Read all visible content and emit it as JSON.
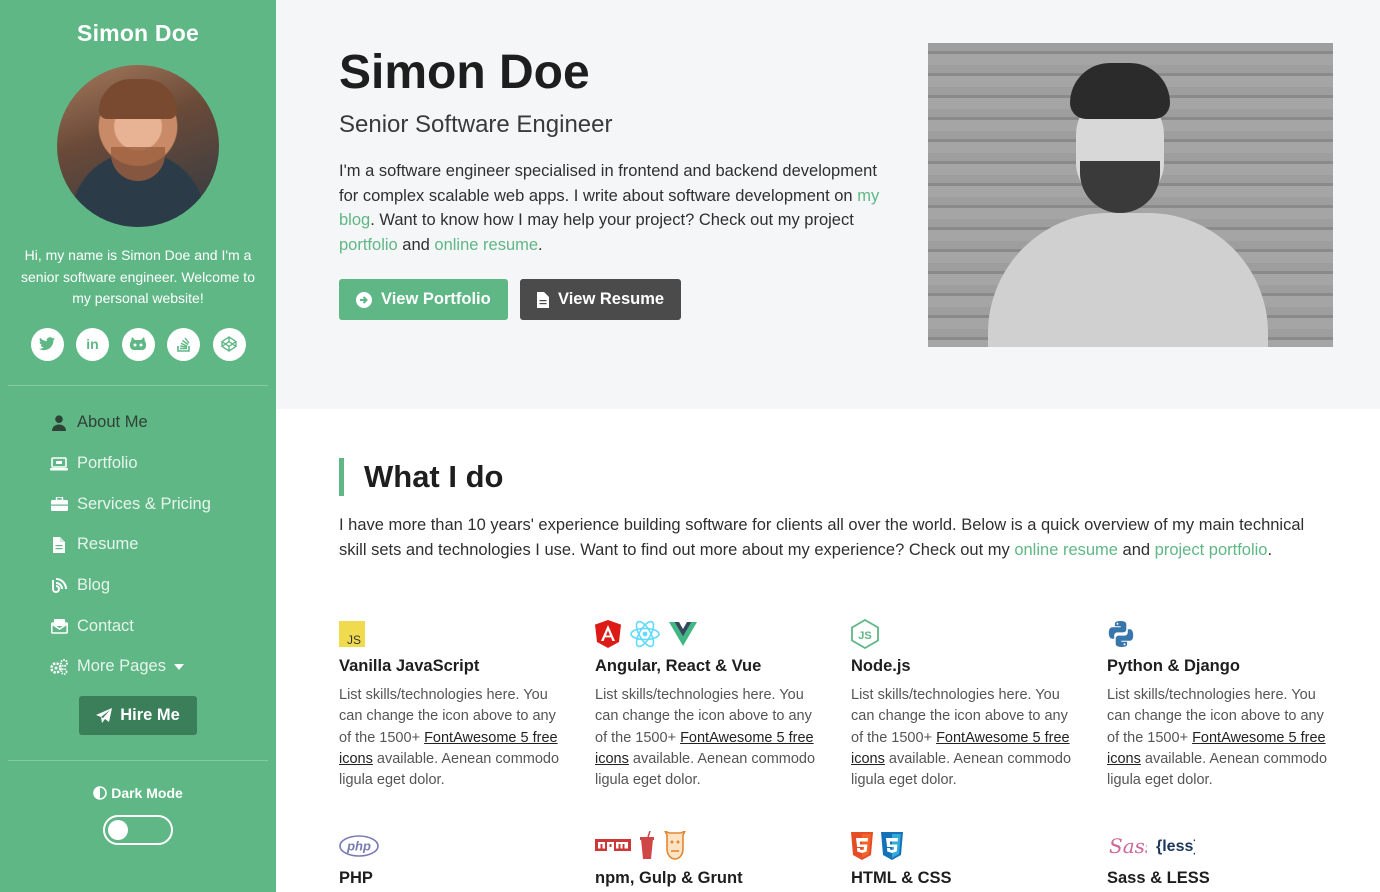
{
  "sidebar": {
    "title": "Simon Doe",
    "intro": "Hi, my name is Simon Doe and I'm a senior software engineer. Welcome to my personal website!",
    "social": [
      {
        "icon": "twitter-icon",
        "glyph": "t"
      },
      {
        "icon": "linkedin-icon",
        "glyph": "in"
      },
      {
        "icon": "github-icon",
        "glyph": "gh"
      },
      {
        "icon": "stackoverflow-icon",
        "glyph": "so"
      },
      {
        "icon": "codepen-icon",
        "glyph": "cp"
      }
    ],
    "nav": [
      {
        "label": "About Me",
        "icon": "user-icon",
        "active": true
      },
      {
        "label": "Portfolio",
        "icon": "laptop-icon"
      },
      {
        "label": "Services & Pricing",
        "icon": "briefcase-icon"
      },
      {
        "label": "Resume",
        "icon": "file-icon"
      },
      {
        "label": "Blog",
        "icon": "blog-icon"
      },
      {
        "label": "Contact",
        "icon": "envelope-icon"
      },
      {
        "label": "More Pages",
        "icon": "cogs-icon"
      }
    ],
    "hire_label": "Hire Me",
    "dark_mode_label": "Dark Mode",
    "colors": {
      "accent": "#5fb785",
      "hire": "#3a7e5a"
    }
  },
  "hero": {
    "name": "Simon Doe",
    "role": "Senior Software Engineer",
    "bio_1": "I'm a software engineer specialised in frontend and backend development for complex scalable web apps. I write about software development on ",
    "bio_link_blog": "my blog",
    "bio_2": ". Want to know how I may help your project? Check out my project ",
    "bio_link_portfolio": "portfolio",
    "bio_3": " and ",
    "bio_link_resume": "online resume",
    "bio_4": ".",
    "btn_portfolio": "View Portfolio",
    "btn_resume": "View Resume"
  },
  "whatido": {
    "title": "What I do",
    "lead_1": "I have more than 10 years' experience building software for clients all over the world. Below is a quick overview of my main technical skill sets and technologies I use. Want to find out more about my experience? Check out my ",
    "lead_link_resume": "online resume",
    "lead_2": " and ",
    "lead_link_portfolio": "project portfolio",
    "lead_3": ".",
    "desc_a": "List skills/technologies here. You can change the icon above to any of the 1500+ ",
    "desc_link": "FontAwesome 5 free icons",
    "desc_b": " available. Aenean commodo ligula eget dolor.",
    "skills": [
      {
        "title": "Vanilla JavaScript"
      },
      {
        "title": "Angular, React & Vue"
      },
      {
        "title": "Node.js"
      },
      {
        "title": "Python & Django"
      },
      {
        "title": "PHP"
      },
      {
        "title": "npm, Gulp & Grunt"
      },
      {
        "title": "HTML & CSS"
      },
      {
        "title": "Sass & LESS"
      }
    ]
  }
}
